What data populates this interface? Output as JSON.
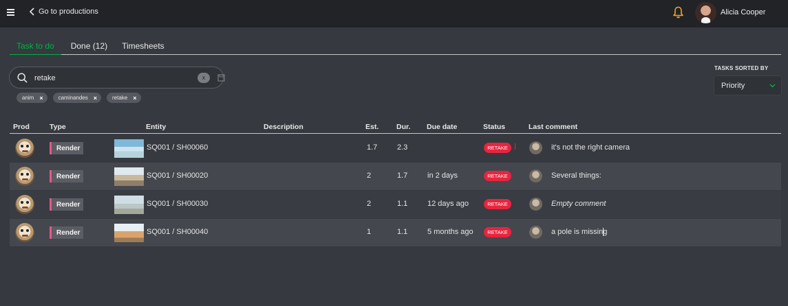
{
  "header": {
    "back_label": "Go to productions",
    "user_name": "Alicia Cooper"
  },
  "tabs": [
    {
      "label": "Task to do",
      "active": true
    },
    {
      "label": "Done (12)",
      "active": false
    },
    {
      "label": "Timesheets",
      "active": false
    }
  ],
  "search": {
    "value": "retake",
    "clear_label": "x"
  },
  "filters": [
    {
      "label": "anim"
    },
    {
      "label": "caminandes"
    },
    {
      "label": "retake"
    }
  ],
  "sort": {
    "label": "TASKS SORTED BY",
    "value": "Priority"
  },
  "table": {
    "columns": [
      "Prod",
      "Type",
      "Entity",
      "Description",
      "Est.",
      "Dur.",
      "Due date",
      "Status",
      "Last comment"
    ],
    "rows": [
      {
        "type": "Render",
        "entity": "SQ001 / SH00060",
        "description": "",
        "est": "1.7",
        "dur": "2.3",
        "due": "",
        "status": "RETAKE",
        "comment": "it's not the right camera"
      },
      {
        "type": "Render",
        "entity": "SQ001 / SH00020",
        "description": "",
        "est": "2",
        "dur": "1.7",
        "due": "in 2 days",
        "status": "RETAKE",
        "comment": "Several things:"
      },
      {
        "type": "Render",
        "entity": "SQ001 / SH00030",
        "description": "",
        "est": "2",
        "dur": "1.1",
        "due": "12 days ago",
        "status": "RETAKE",
        "comment": "Empty comment"
      },
      {
        "type": "Render",
        "entity": "SQ001 / SH00040",
        "description": "",
        "est": "1",
        "dur": "1.1",
        "due": "5 months ago",
        "status": "RETAKE",
        "comment": "a pole is missing"
      }
    ]
  },
  "colors": {
    "accent_green": "#00b242",
    "retake_red": "#e8243f",
    "render_pink": "#e7578b",
    "bell_orange": "#f5a623"
  },
  "icons": [
    "menu-icon",
    "chevron-left-icon",
    "bell-icon",
    "search-icon",
    "save-icon",
    "chevron-down-icon"
  ]
}
